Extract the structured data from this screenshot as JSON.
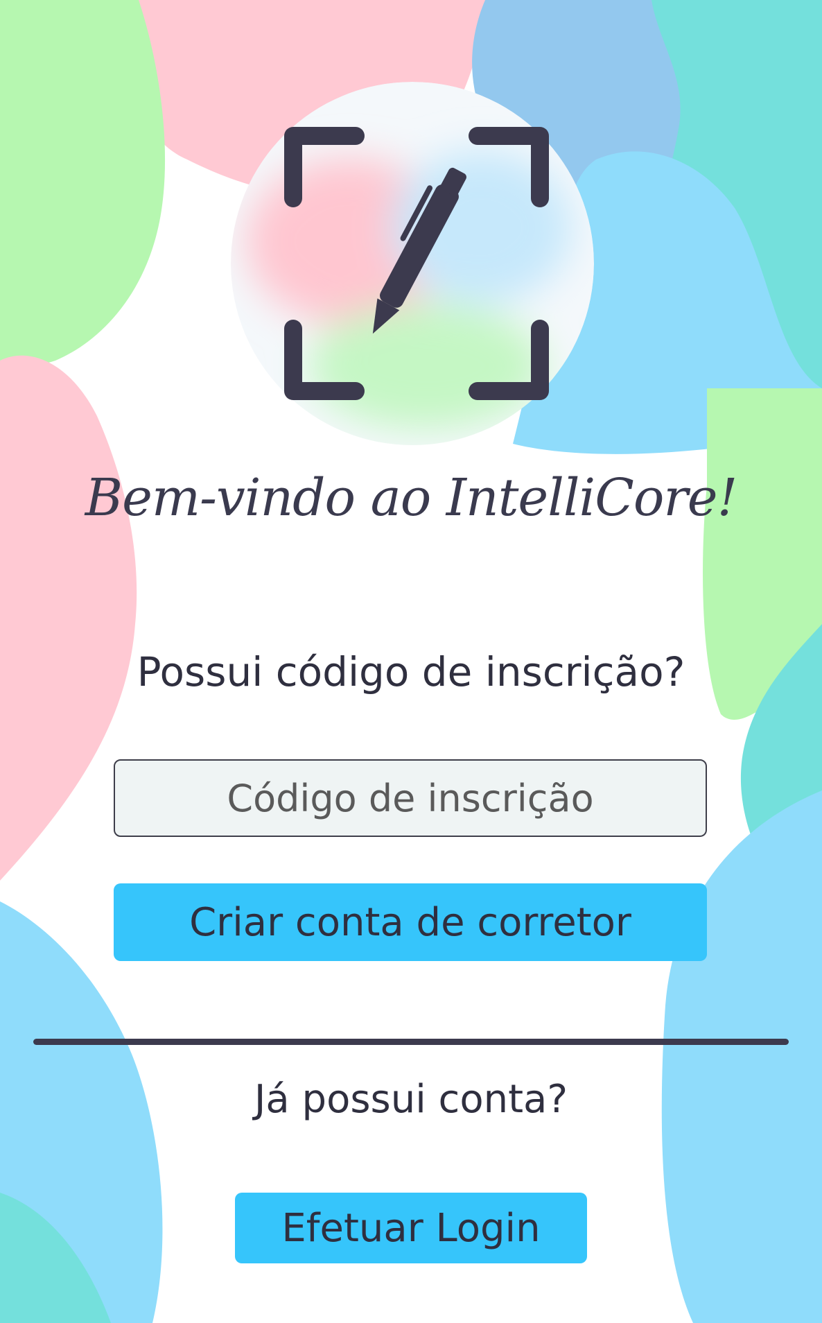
{
  "welcome": {
    "title": "Bem-vindo ao IntelliCore!"
  },
  "signup": {
    "question": "Possui código de inscrição?",
    "code_placeholder": "Código de inscrição",
    "code_value": "",
    "create_button_label": "Criar conta de corretor"
  },
  "login": {
    "question": "Já possui conta?",
    "button_label": "Efetuar Login"
  },
  "icons": {
    "logo": "pen-in-frame-icon"
  },
  "colors": {
    "accent": "#36c5fb",
    "text": "#2f2f3f",
    "divider": "#3c3a4e",
    "blob_pink": "#ffc9d3",
    "blob_green": "#b6f7b0",
    "blob_blue": "#8fdcfb",
    "blob_teal": "#74e0dc"
  }
}
